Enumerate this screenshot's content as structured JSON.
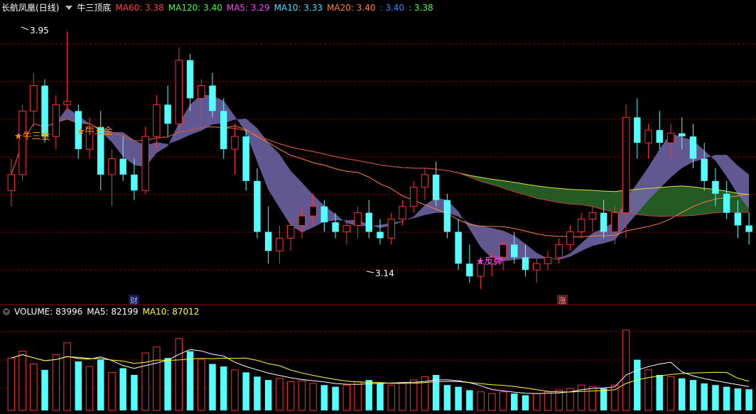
{
  "header": {
    "stock_name": "长航凤凰(日线)",
    "indicator_name": "牛三顶底",
    "ma_items": [
      {
        "label": "MA60: 3.38",
        "color": "#ff4040"
      },
      {
        "label": "MA120: 3.40",
        "color": "#40ff40"
      },
      {
        "label": "MA5: 3.29",
        "color": "#ff40ff"
      },
      {
        "label": "MA10: 3.33",
        "color": "#40e0ff"
      },
      {
        "label": "MA20: 3.40",
        "color": "#ff8040"
      },
      {
        "label": ": 3.40",
        "color": "#4080ff"
      },
      {
        "label": ": 3.38",
        "color": "#40ff40"
      }
    ]
  },
  "volume_header": {
    "items": [
      {
        "label": "VOLUME: 83996",
        "color": "#ffffff"
      },
      {
        "label": "MA5: 82199",
        "color": "#ffffff"
      },
      {
        "label": "MA10: 87012",
        "color": "#ffff40"
      }
    ]
  },
  "annotations": {
    "high_label": "3.95",
    "low_label": "3.14",
    "signal_top_1": "★牛三金",
    "signal_top_2": "★牛三金",
    "signal_rebound": "★反弹",
    "marker_cai": "财",
    "marker_zhang": "涨"
  },
  "colors": {
    "up": "#ff3030",
    "down": "#54ffff",
    "grid": "#7a0000",
    "ribbon_purple": "#b030b0",
    "ribbon_teal": "#30a0a0",
    "cloud_red": "#8a2626",
    "cloud_green": "#2a6a2a"
  },
  "chart_data": {
    "type": "candlestick",
    "price_range": [
      3.1,
      4.0
    ],
    "candles": [
      [
        3.45,
        3.55,
        3.4,
        3.5
      ],
      [
        3.5,
        3.72,
        3.48,
        3.7
      ],
      [
        3.7,
        3.82,
        3.65,
        3.78
      ],
      [
        3.78,
        3.8,
        3.6,
        3.62
      ],
      [
        3.62,
        3.75,
        3.58,
        3.72
      ],
      [
        3.72,
        3.95,
        3.7,
        3.73
      ],
      [
        3.7,
        3.72,
        3.55,
        3.58
      ],
      [
        3.58,
        3.68,
        3.55,
        3.65
      ],
      [
        3.65,
        3.7,
        3.45,
        3.5
      ],
      [
        3.5,
        3.58,
        3.4,
        3.55
      ],
      [
        3.55,
        3.62,
        3.48,
        3.5
      ],
      [
        3.5,
        3.55,
        3.42,
        3.45
      ],
      [
        3.45,
        3.65,
        3.44,
        3.62
      ],
      [
        3.62,
        3.75,
        3.58,
        3.72
      ],
      [
        3.72,
        3.78,
        3.62,
        3.66
      ],
      [
        3.66,
        3.9,
        3.64,
        3.86
      ],
      [
        3.86,
        3.88,
        3.7,
        3.74
      ],
      [
        3.74,
        3.8,
        3.66,
        3.78
      ],
      [
        3.78,
        3.82,
        3.68,
        3.7
      ],
      [
        3.7,
        3.74,
        3.55,
        3.58
      ],
      [
        3.58,
        3.66,
        3.5,
        3.62
      ],
      [
        3.62,
        3.64,
        3.45,
        3.48
      ],
      [
        3.48,
        3.52,
        3.3,
        3.32
      ],
      [
        3.32,
        3.4,
        3.22,
        3.26
      ],
      [
        3.26,
        3.34,
        3.22,
        3.3
      ],
      [
        3.3,
        3.36,
        3.26,
        3.34
      ],
      [
        3.34,
        3.4,
        3.3,
        3.37
      ],
      [
        3.37,
        3.44,
        3.34,
        3.4
      ],
      [
        3.4,
        3.42,
        3.32,
        3.35
      ],
      [
        3.35,
        3.38,
        3.3,
        3.32
      ],
      [
        3.32,
        3.36,
        3.28,
        3.34
      ],
      [
        3.34,
        3.4,
        3.3,
        3.38
      ],
      [
        3.38,
        3.42,
        3.3,
        3.32
      ],
      [
        3.32,
        3.36,
        3.28,
        3.3
      ],
      [
        3.3,
        3.38,
        3.28,
        3.36
      ],
      [
        3.36,
        3.42,
        3.34,
        3.4
      ],
      [
        3.4,
        3.48,
        3.38,
        3.46
      ],
      [
        3.46,
        3.52,
        3.42,
        3.5
      ],
      [
        3.5,
        3.54,
        3.4,
        3.42
      ],
      [
        3.42,
        3.44,
        3.3,
        3.32
      ],
      [
        3.32,
        3.36,
        3.2,
        3.22
      ],
      [
        3.22,
        3.28,
        3.16,
        3.18
      ],
      [
        3.18,
        3.24,
        3.14,
        3.22
      ],
      [
        3.22,
        3.26,
        3.18,
        3.24
      ],
      [
        3.24,
        3.3,
        3.2,
        3.28
      ],
      [
        3.28,
        3.32,
        3.22,
        3.24
      ],
      [
        3.24,
        3.28,
        3.18,
        3.2
      ],
      [
        3.2,
        3.24,
        3.16,
        3.22
      ],
      [
        3.22,
        3.26,
        3.2,
        3.24
      ],
      [
        3.24,
        3.3,
        3.22,
        3.28
      ],
      [
        3.28,
        3.34,
        3.26,
        3.32
      ],
      [
        3.32,
        3.38,
        3.3,
        3.36
      ],
      [
        3.36,
        3.4,
        3.32,
        3.38
      ],
      [
        3.38,
        3.42,
        3.3,
        3.32
      ],
      [
        3.32,
        3.4,
        3.28,
        3.38
      ],
      [
        3.38,
        3.72,
        3.3,
        3.68
      ],
      [
        3.68,
        3.74,
        3.55,
        3.6
      ],
      [
        3.6,
        3.66,
        3.55,
        3.64
      ],
      [
        3.64,
        3.7,
        3.58,
        3.6
      ],
      [
        3.6,
        3.66,
        3.55,
        3.63
      ],
      [
        3.63,
        3.68,
        3.58,
        3.62
      ],
      [
        3.62,
        3.66,
        3.52,
        3.55
      ],
      [
        3.55,
        3.6,
        3.45,
        3.48
      ],
      [
        3.48,
        3.52,
        3.4,
        3.44
      ],
      [
        3.44,
        3.48,
        3.36,
        3.38
      ],
      [
        3.38,
        3.42,
        3.3,
        3.34
      ],
      [
        3.34,
        3.38,
        3.28,
        3.32
      ]
    ],
    "volume": [
      62,
      70,
      55,
      48,
      66,
      80,
      58,
      52,
      60,
      45,
      50,
      42,
      68,
      75,
      62,
      85,
      70,
      60,
      55,
      52,
      48,
      45,
      40,
      36,
      38,
      34,
      35,
      32,
      30,
      28,
      30,
      34,
      36,
      32,
      30,
      33,
      36,
      40,
      42,
      30,
      28,
      24,
      22,
      20,
      22,
      20,
      18,
      20,
      22,
      24,
      26,
      30,
      28,
      26,
      30,
      95,
      60,
      48,
      42,
      40,
      38,
      36,
      32,
      30,
      28,
      26,
      25
    ],
    "volume_range": [
      0,
      110
    ]
  }
}
